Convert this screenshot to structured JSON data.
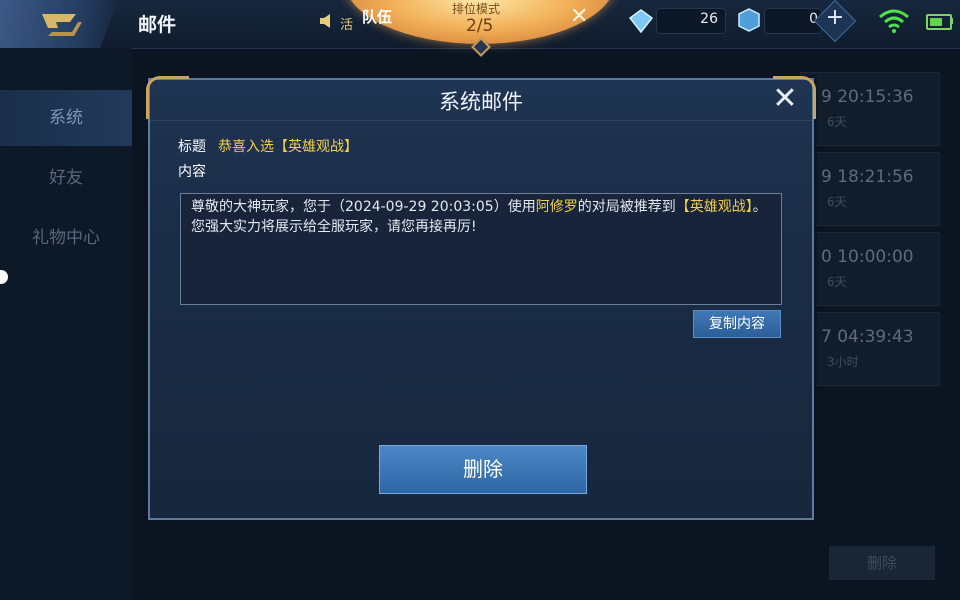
{
  "header": {
    "title": "邮件",
    "notice_text": "活",
    "team_label": "队伍",
    "rank_mode_label": "排位模式",
    "rank_count": "2/5",
    "diamonds": "26",
    "coupons": "0"
  },
  "sidebar": {
    "items": [
      {
        "label": "系统",
        "active": true
      },
      {
        "label": "好友",
        "active": false
      },
      {
        "label": "礼物中心",
        "active": false
      }
    ]
  },
  "mail_list": [
    {
      "time": "9 20:15:36",
      "age": "6天"
    },
    {
      "time": "9 18:21:56",
      "age": "6天"
    },
    {
      "time": "0 10:00:00",
      "age": "6天"
    },
    {
      "time": "7 04:39:43",
      "age": "3小时"
    }
  ],
  "bg_delete_label": "删除",
  "dialog": {
    "title": "系统邮件",
    "subject_label": "标题",
    "subject": "恭喜入选【英雄观战】",
    "content_label": "内容",
    "content": {
      "part1": "尊敬的大神玩家，您于（2024-09-29 20:03:05）使用",
      "hero": "阿修罗",
      "part2": "的对局被推荐到",
      "tag": "【英雄观战】",
      "part3": "。",
      "line2": "您强大实力将展示给全服玩家，请您再接再厉!"
    },
    "copy_label": "复制内容",
    "delete_label": "删除"
  },
  "colors": {
    "highlight": "#f1cf4b",
    "button_blue": "#2f67a6",
    "background": "#0b1522"
  }
}
